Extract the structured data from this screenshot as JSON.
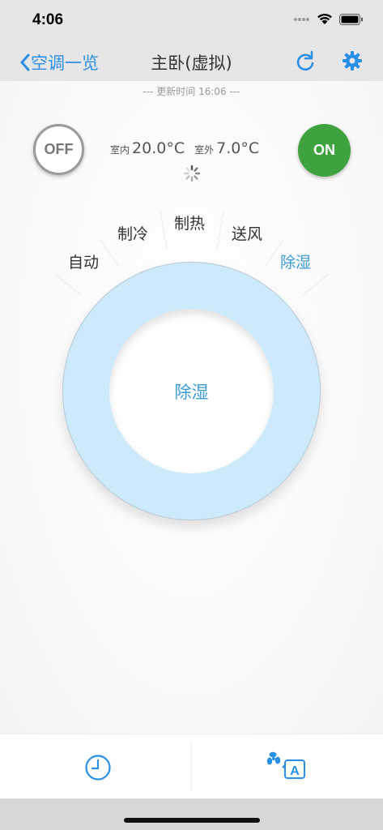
{
  "status_bar": {
    "time": "4:06"
  },
  "nav": {
    "back_label": "空调一览",
    "title": "主卧(虚拟)"
  },
  "info": {
    "update_time": "--- 更新时间 16:06 ---",
    "indoor_label": "室内",
    "indoor_temp": "20.0°C",
    "outdoor_label": "室外",
    "outdoor_temp": "7.0°C"
  },
  "power": {
    "off_label": "OFF",
    "on_label": "ON"
  },
  "modes": [
    {
      "label": "自动"
    },
    {
      "label": "制冷"
    },
    {
      "label": "制热"
    },
    {
      "label": "送风"
    },
    {
      "label": "除湿"
    }
  ],
  "selected_mode": "除湿",
  "ring": {
    "label": "除湿"
  },
  "bottom_tabs": {
    "timer_icon": "clock-icon",
    "fan_icon": "fan-auto-icon"
  },
  "colors": {
    "accent": "#2a8fe6",
    "on_green": "#3ea33e",
    "ring_fill": "#cdeafc",
    "active_mode": "#3a9bd8"
  }
}
